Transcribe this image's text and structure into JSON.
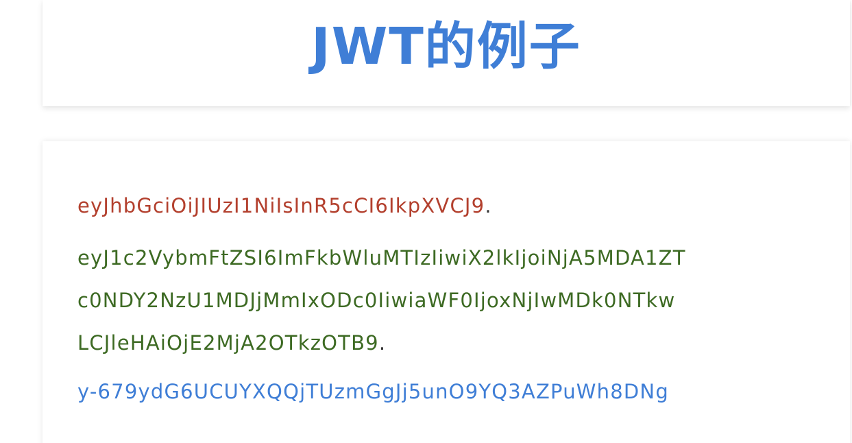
{
  "title": "JWT的例子",
  "token": {
    "header": "eyJhbGciOiJIUzI1NiIsInR5cCI6IkpXVCJ9",
    "payload_lines": [
      "eyJ1c2VybmFtZSI6ImFkbWluMTIzIiwiX2lkIjoiNjA5MDA1ZT",
      "c0NDY2NzU1MDJjMmIxODc0IiwiaWF0IjoxNjIwMDk0NTkw",
      "LCJleHAiOjE2MjA2OTkzOTB9"
    ],
    "signature": "y-679ydG6UCUYXQQjTUzmGgJj5unO9YQ3AZPuWh8DNg",
    "separator": "."
  },
  "colors": {
    "title": "#3f7ed6",
    "header": "#b3402e",
    "payload": "#3d6a23",
    "signature": "#3f7ed6",
    "separator": "#333333"
  }
}
